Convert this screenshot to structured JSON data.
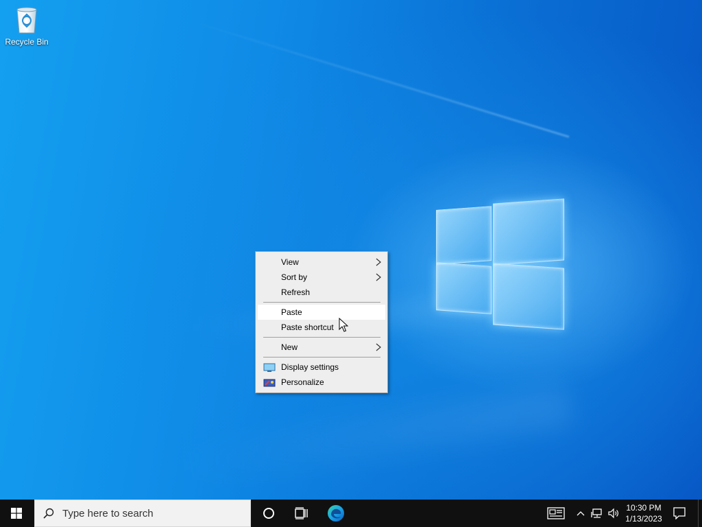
{
  "desktop": {
    "icons": [
      {
        "label": "Recycle Bin",
        "icon": "recycle-bin-icon"
      }
    ]
  },
  "context_menu": {
    "items": [
      {
        "label": "View",
        "submenu": true
      },
      {
        "label": "Sort by",
        "submenu": true
      },
      {
        "label": "Refresh",
        "submenu": false
      },
      {
        "label": "Paste",
        "submenu": false,
        "highlighted": true
      },
      {
        "label": "Paste shortcut",
        "submenu": false
      },
      {
        "label": "New",
        "submenu": true
      },
      {
        "label": "Display settings",
        "icon": "display-settings-icon"
      },
      {
        "label": "Personalize",
        "icon": "personalize-icon"
      }
    ]
  },
  "taskbar": {
    "search_placeholder": "Type here to search",
    "pinned": [
      "cortana-icon",
      "task-view-icon",
      "edge-icon"
    ],
    "tray": [
      "news-icon",
      "chevron-up-icon",
      "network-icon",
      "volume-icon"
    ],
    "clock": {
      "time": "10:30 PM",
      "date": "1/13/2023"
    }
  },
  "colors": {
    "taskbar": "#101010",
    "menu_bg": "#eeeeee",
    "menu_highlight": "#ffffff",
    "wallpaper_blue": "#0f8ae6"
  }
}
